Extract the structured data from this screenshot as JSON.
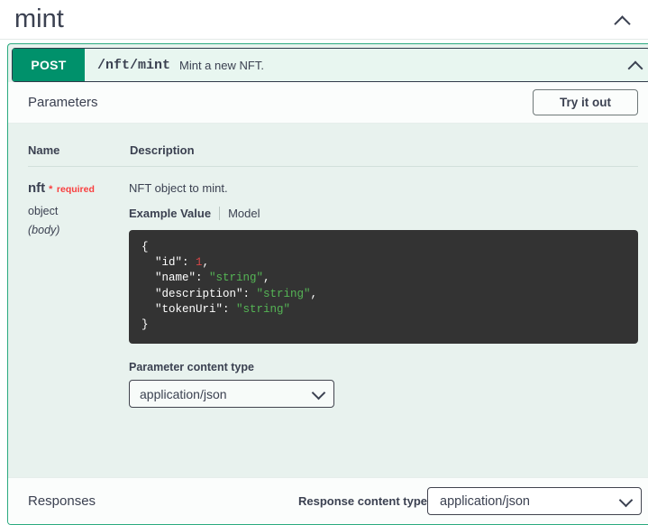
{
  "tag": {
    "name": "mint",
    "collapse_icon": "chevron-up-icon"
  },
  "operation": {
    "method": "POST",
    "path": "/nft/mint",
    "summary": "Mint a new NFT.",
    "collapse_icon": "chevron-up-icon",
    "deeplink_icon": "arrow-return-icon",
    "method_color": "#00916b",
    "border_color": "#2aaa7f",
    "body_background": "#e8f2ee"
  },
  "parameters_section": {
    "title": "Parameters",
    "try_it_out_label": "Try it out",
    "columns": {
      "name": "Name",
      "description": "Description"
    },
    "rows": [
      {
        "name": "nft",
        "required_mark": "*",
        "required_label": "required",
        "required_color": "#f93e3e",
        "type": "object",
        "location": "(body)",
        "description": "NFT object to mint.",
        "tabs": [
          {
            "label": "Example Value",
            "active": true
          },
          {
            "label": "Model",
            "active": false
          }
        ],
        "example_value": {
          "open_brace": "{",
          "lines": [
            {
              "key": "\"id\"",
              "sep": ": ",
              "value": "1",
              "value_kind": "number",
              "comma": ","
            },
            {
              "key": "\"name\"",
              "sep": ": ",
              "value": "\"string\"",
              "value_kind": "string",
              "comma": ","
            },
            {
              "key": "\"description\"",
              "sep": ": ",
              "value": "\"string\"",
              "value_kind": "string",
              "comma": ","
            },
            {
              "key": "\"tokenUri\"",
              "sep": ": ",
              "value": "\"string\"",
              "value_kind": "string",
              "comma": ""
            }
          ],
          "close_brace": "}",
          "code_background": "#333333",
          "string_color": "#55b555",
          "number_color": "#d64747"
        },
        "content_type": {
          "label": "Parameter content type",
          "selected": "application/json",
          "caret_icon": "chevron-down-icon"
        }
      }
    ]
  },
  "responses_section": {
    "title": "Responses",
    "content_type_label": "Response content type",
    "content_type_selected": "application/json",
    "caret_icon": "chevron-down-icon"
  }
}
